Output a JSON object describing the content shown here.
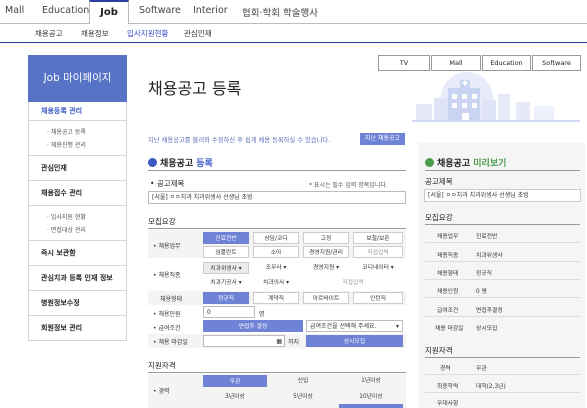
{
  "topnav": {
    "items": [
      "Mall",
      "Education",
      "Job",
      "Software",
      "Interior",
      "협회·학회 학술행사"
    ]
  },
  "subnav": {
    "items": [
      "채용공고",
      "채용정보",
      "입사지원현황",
      "관심인재"
    ]
  },
  "sidebar": {
    "title": "Job 마이페이지",
    "sections": [
      {
        "label": "채용등록 관리",
        "subs": [
          "채용공고 등록",
          "채용진행 관리"
        ]
      },
      {
        "label": "관심인재",
        "subs": []
      },
      {
        "label": "채용접수 관리",
        "subs": [
          "입사지원 현황",
          "면접대상 관리"
        ]
      },
      {
        "label": "즉시 보관함",
        "subs": []
      },
      {
        "label": "관심치과 등록 인재 정보",
        "subs": []
      },
      {
        "label": "병원정보수정",
        "subs": []
      },
      {
        "label": "회원정보 관리",
        "subs": []
      }
    ]
  },
  "tabs": [
    "TV",
    "Mall",
    "Education",
    "Software"
  ],
  "page": {
    "title": "채용공고 등록",
    "hint": "지난 채용공고를 불러와 수정하신 후 쉽게 채용 등록하실 수 있습니다.",
    "load_button": "지난 채용공고"
  },
  "form": {
    "section_prefix": "채용공고",
    "section_suffix": "등록",
    "announcement_label": "공고제목",
    "required_note": "* 표시는 필수 입력 항목입니다.",
    "title_value": "[서울] ㅇㅇ치과 치과위생사 선생님 초빙",
    "recruit_label": "모집요강",
    "job_label": "• 채용업무",
    "job_row1": [
      "진료전반",
      "상담/코디",
      "고정",
      "보철/보존"
    ],
    "job_row2": [
      "임플란트",
      "소아",
      "경영지원/관리",
      "직접입력"
    ],
    "type_label": "• 채용직종",
    "type_row1": [
      "치과위생사 ▾",
      "조무사 ▾",
      "경영지원 ▾",
      "코디네이터 ▾"
    ],
    "type_row2": [
      "치과기공사 ▾",
      "치과의사 ▾",
      "직접입력"
    ],
    "employ_label": "채용형태",
    "employ_row": [
      "정규직",
      "계약직",
      "아르바이트",
      "인턴직"
    ],
    "count_label": "• 채용인원",
    "count_value": "0",
    "count_unit": "명",
    "pay_label": "• 급여조건",
    "pay_button": "면접후 결정",
    "pay_select": "급여조건을 선택해 주세요.",
    "deadline_label": "• 채용 마감일",
    "deadline_unit": "까지",
    "deadline_button": "상시모집",
    "qualify_label": "지원자격",
    "career_label": "• 경력",
    "career_row1": [
      "무관",
      "신입",
      "1년이상"
    ],
    "career_row2": [
      "3년이상",
      "5년이상",
      "10년이상"
    ]
  },
  "preview": {
    "section_prefix": "채용공고",
    "section_suffix": "미리보기",
    "announcement_label": "공고제목",
    "title_value": "[서울] ㅇㅇ치과 치과위생사 선생님 초빙",
    "recruit_label": "모집요강",
    "rows": [
      {
        "k": "채용업무",
        "v": "진료전반"
      },
      {
        "k": "채용직종",
        "v": "치과위생사"
      },
      {
        "k": "채용형태",
        "v": "정규직"
      },
      {
        "k": "채용인원",
        "v": "0 명"
      },
      {
        "k": "급여조건",
        "v": "면접후결정"
      },
      {
        "k": "채용 마감일",
        "v": "상시모집"
      }
    ],
    "qualify_label": "지원자격",
    "qrows": [
      {
        "k": "경력",
        "v": "무관"
      },
      {
        "k": "최종학력",
        "v": "대학(2,3년)"
      },
      {
        "k": "우대사항",
        "v": ""
      }
    ]
  },
  "colors": {
    "accent": "#5773c5",
    "selected": "#6e82d6",
    "nav_border": "#2b3ea0"
  }
}
